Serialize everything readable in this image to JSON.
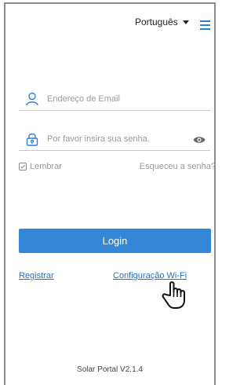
{
  "header": {
    "language": "Português",
    "language_icon": "chevron-down-icon",
    "menu_icon": "hamburger-menu-icon"
  },
  "form": {
    "email_placeholder": "Endereço de Email",
    "email_value": "",
    "email_icon": "user-icon",
    "password_placeholder": "Por favor insira sua senha.",
    "password_value": "",
    "password_icon": "lock-icon",
    "show_password_icon": "eye-icon",
    "remember_label": "Lembrar",
    "remember_checked": false,
    "forgot_label": "Esqueceu a senha?"
  },
  "actions": {
    "login_label": "Login",
    "register_label": "Registrar",
    "wifi_config_label": "Configuração Wi-Fi",
    "pointer_icon": "hand-pointer-icon"
  },
  "footer": {
    "version": "Solar Portal V2.1.4"
  },
  "colors": {
    "accent": "#3486d6",
    "link": "#2b6fbf",
    "frame": "#8c8c8c"
  }
}
